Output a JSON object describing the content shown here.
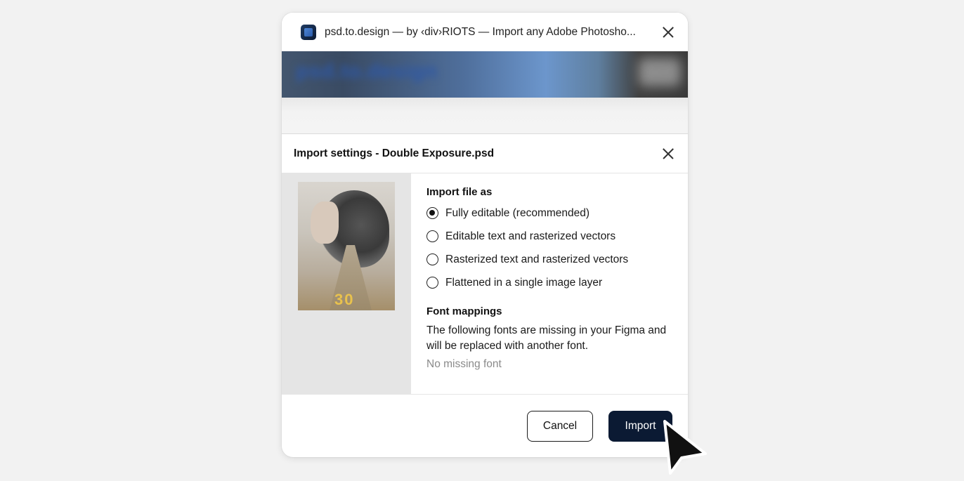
{
  "window": {
    "title": "psd.to.design — by ‹div›RIOTS — Import any Adobe Photosho...",
    "app_icon": "psd-to-design-logo-icon",
    "close_icon": "close-icon"
  },
  "banner": {
    "text": "psd.to.design"
  },
  "dialog": {
    "title": "Import settings - Double Exposure.psd",
    "close_icon": "close-icon",
    "preview": {
      "overlay_text": "30"
    },
    "import_section": {
      "title": "Import file as",
      "options": [
        {
          "label": "Fully editable (recommended)",
          "selected": true
        },
        {
          "label": "Editable text and rasterized vectors",
          "selected": false
        },
        {
          "label": "Rasterized text and rasterized vectors",
          "selected": false
        },
        {
          "label": "Flattened in a single image layer",
          "selected": false
        }
      ]
    },
    "font_section": {
      "title": "Font mappings",
      "description": "The following fonts are missing in your Figma and will be replaced with another font.",
      "empty_text": "No missing font"
    },
    "footer": {
      "cancel_label": "Cancel",
      "import_label": "Import"
    }
  },
  "colors": {
    "background": "#f2f2f2",
    "primary_button": "#0b1a33",
    "muted_text": "#8a8a8a"
  }
}
